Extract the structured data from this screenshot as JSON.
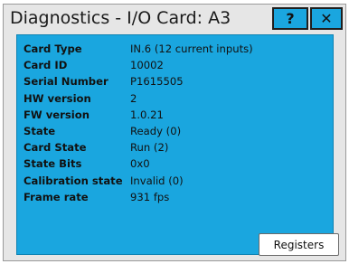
{
  "dialog": {
    "title": "Diagnostics - I/O Card: A3",
    "help_label": "?",
    "close_label": "✕"
  },
  "fields": [
    {
      "label": "Card Type",
      "value": "IN.6 (12 current inputs)"
    },
    {
      "label": "Card ID",
      "value": "10002"
    },
    {
      "label": "Serial Number",
      "value": "P1615505"
    },
    {
      "label": "HW version",
      "value": "2"
    },
    {
      "label": "FW version",
      "value": "1.0.21"
    },
    {
      "label": "State",
      "value": "Ready (0)"
    },
    {
      "label": "Card State",
      "value": "Run (2)"
    },
    {
      "label": "State Bits",
      "value": "0x0"
    },
    {
      "label": "Calibration state",
      "value": "Invalid (0)"
    },
    {
      "label": "Frame rate",
      "value": "931 fps"
    }
  ],
  "buttons": {
    "registers_label": "Registers"
  },
  "colors": {
    "panel": "#1aa6df",
    "title_bar": "#e6e6e6"
  }
}
